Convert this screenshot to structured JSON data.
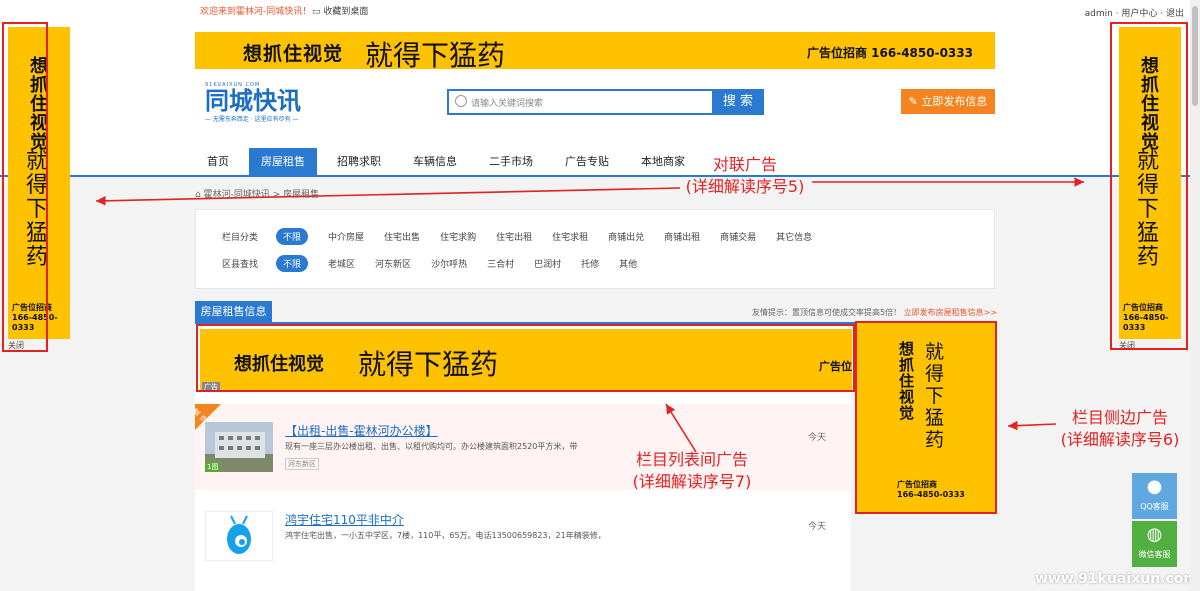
{
  "topbar": {
    "welcome": "欢迎来到霍林河-同城快讯！",
    "favorite": "收藏到桌面",
    "user_links": "admin · 用户中心 · 退出"
  },
  "top_banner": {
    "slogan_bold": "想抓住视觉",
    "slogan_main": "就得下猛药",
    "contact": "广告位招商 166-4850-0333"
  },
  "logo": {
    "small": "91KUAIXUN.COM",
    "name": "同城快讯",
    "slogan": "— 无需东奔西走 · 这里应有尽有 —"
  },
  "search": {
    "placeholder": "请输入关键词搜索",
    "button": "搜 索"
  },
  "publish_button": "立即发布信息",
  "nav": [
    "首页",
    "房屋租售",
    "招聘求职",
    "车辆信息",
    "二手市场",
    "广告专贴",
    "本地商家"
  ],
  "breadcrumb": "霍林河-同城快讯 > 房屋租售",
  "filters": {
    "category_label": "栏目分类",
    "categories": [
      "不限",
      "中介房屋",
      "住宅出售",
      "住宅求购",
      "住宅出租",
      "住宅求租",
      "商铺出兑",
      "商铺出租",
      "商铺交易",
      "其它信息"
    ],
    "district_label": "区县查找",
    "districts": [
      "不限",
      "老城区",
      "河东新区",
      "沙尔呼热",
      "三合村",
      "巴润村",
      "托修",
      "其他"
    ]
  },
  "section": {
    "title": "房屋租售信息",
    "tip": "友情提示：置顶信息可使成交率提高5倍！",
    "tip_link": "立即发布房屋租售信息>>"
  },
  "list_banner": {
    "slogan_bold": "想抓住视觉",
    "slogan_main": "就得下猛药",
    "contact": "广告位",
    "tag": "广告"
  },
  "items": [
    {
      "title": "【出租-出售-霍林河办公楼】",
      "desc": "现有一座三层办公楼出租、出售、以租代购均可。办公楼建筑面积2520平方米，带",
      "area": "河东新区",
      "date": "今天",
      "badge": "置顶",
      "img_count": "1图"
    },
    {
      "title": "鸿宇住宅110平非中介",
      "desc": "鸿宇住宅出售，一小五中学区，7楼，110平，65万。电话13500659823，21年精装修，全屋品",
      "area": "",
      "date": "今天"
    }
  ],
  "couplet": {
    "vertical_bold": "想抓住视觉",
    "vertical_main": "就得下猛药",
    "phone_label": "广告位招商",
    "phone": "166-4850-0333",
    "close": "关闭"
  },
  "side_ad": {
    "vertical_bold": "想抓住视觉",
    "vertical_main": "就得下猛药",
    "phone_label": "广告位招商",
    "phone": "166-4850-0333"
  },
  "annotations": {
    "couplet": "对联广告\n(详细解读序号5)",
    "list": "栏目列表间广告\n(详细解读序号7)",
    "side": "栏目侧边广告\n(详细解读序号6)"
  },
  "float_buttons": [
    "QQ客服",
    "微信客服"
  ],
  "watermark": "www.91kuaixun.com",
  "colors": {
    "accent": "#2a7ad1",
    "ad_yellow": "#fec200",
    "annotation_red": "#e32222",
    "orange": "#f5841f"
  }
}
